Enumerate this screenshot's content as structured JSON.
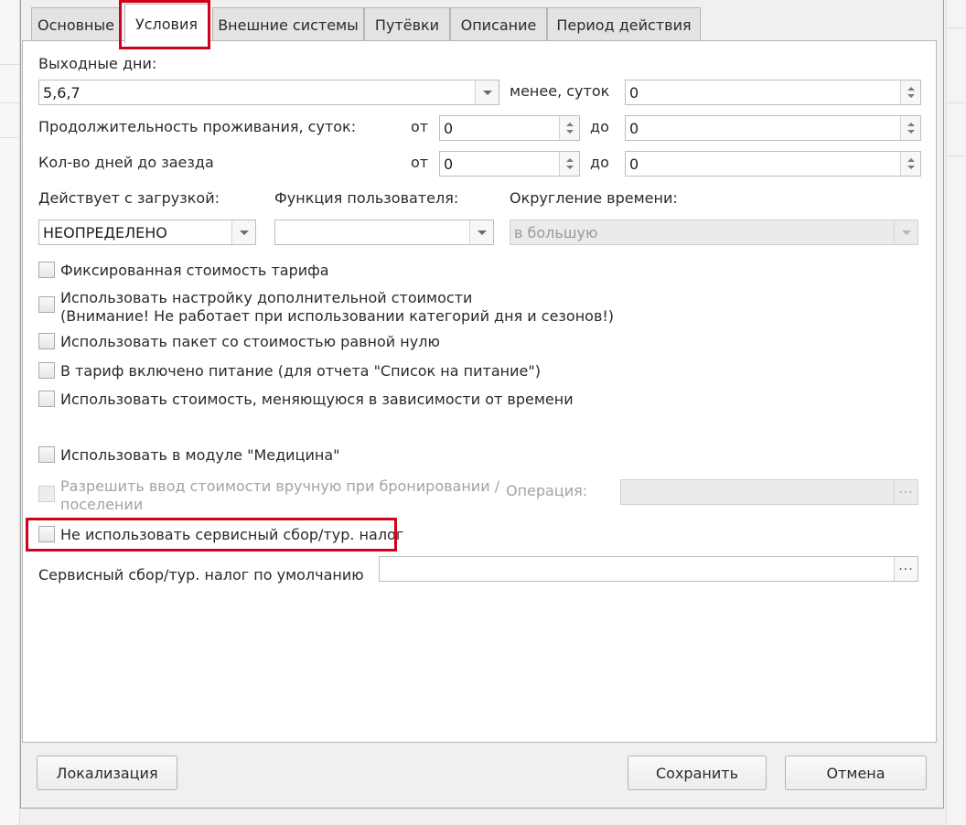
{
  "tabs": [
    "Основные",
    "Условия",
    "Внешние системы",
    "Путёвки",
    "Описание",
    "Период действия"
  ],
  "weekends": {
    "label": "Выходные дни:",
    "value": "5,6,7",
    "less_label": "менее, суток",
    "less_value": "0"
  },
  "stay_duration": {
    "label": "Продолжительность проживания, суток:",
    "from_label": "от",
    "from_value": "0",
    "to_label": "до",
    "to_value": "0"
  },
  "days_before": {
    "label": "Кол-во дней до заезда",
    "from_label": "от",
    "from_value": "0",
    "to_label": "до",
    "to_value": "0"
  },
  "load_mode": {
    "label": "Действует с загрузкой:",
    "value": "НЕОПРЕДЕЛЕНО"
  },
  "user_function": {
    "label": "Функция пользователя:",
    "value": ""
  },
  "rounding": {
    "label": "Округление времени:",
    "value": "в большую"
  },
  "checkboxes": {
    "fixed_price": "Фиксированная стоимость тарифа",
    "extra_cost_line1": "Использовать настройку дополнительной стоимости",
    "extra_cost_line2": "(Внимание! Не работает при использовании категорий дня и сезонов!)",
    "zero_package": "Использовать пакет со стоимостью равной нулю",
    "meals": "В тариф включено питание (для отчета \"Список на питание\")",
    "time_cost": "Использовать стоимость, меняющуюся в зависимости от времени",
    "medicine": "Использовать в модуле \"Медицина\"",
    "manual_price_line1": "Разрешить ввод стоимости вручную при бронировании /",
    "manual_price_line2": "поселении",
    "no_service_fee": "Не использовать сервисный сбор/тур. налог"
  },
  "operation": {
    "label": "Операция:",
    "value": ""
  },
  "default_fee": {
    "label": "Сервисный сбор/тур. налог по умолчанию",
    "value": ""
  },
  "buttons": {
    "localization": "Локализация",
    "save": "Сохранить",
    "cancel": "Отмена"
  },
  "colors": {
    "highlight": "#d0021b"
  }
}
